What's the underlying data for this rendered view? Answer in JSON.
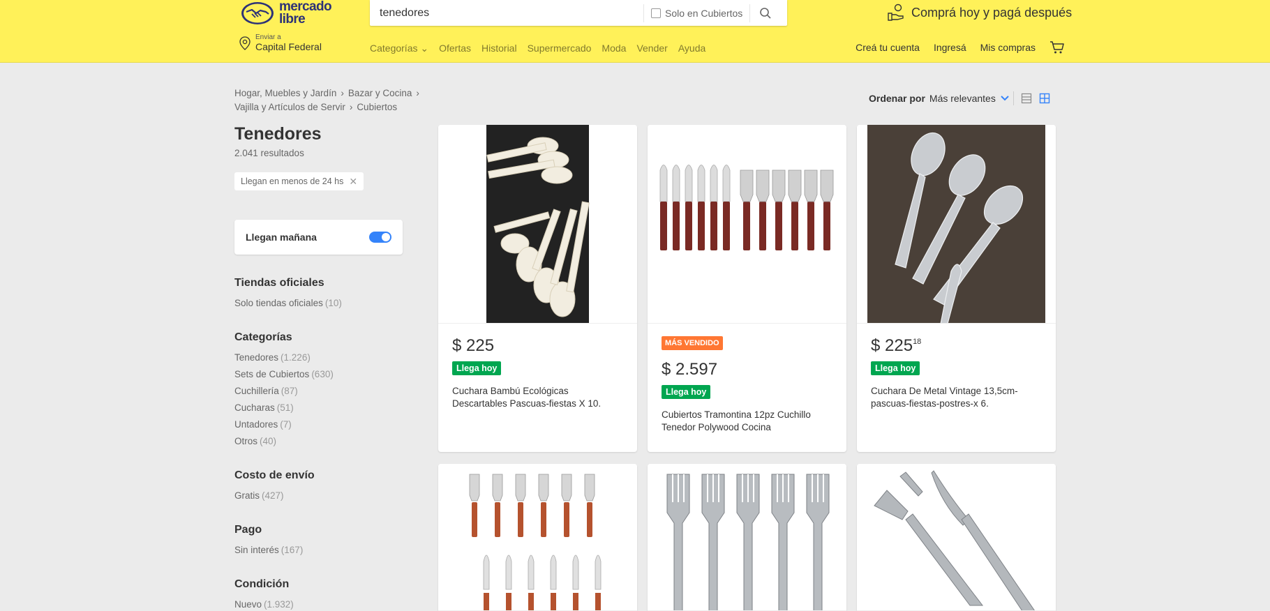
{
  "header": {
    "logo_text": "mercado libre",
    "search": {
      "value": "tenedores",
      "filter_label": "Solo en Cubiertos"
    },
    "promo": "Comprá hoy y pagá después",
    "location": {
      "small": "Enviar a",
      "big": "Capital Federal"
    },
    "nav": [
      "Categorías",
      "Ofertas",
      "Historial",
      "Supermercado",
      "Moda",
      "Vender",
      "Ayuda"
    ],
    "nav_right": [
      "Creá tu cuenta",
      "Ingresá",
      "Mis compras"
    ]
  },
  "breadcrumb": [
    "Hogar, Muebles y Jardín",
    "Bazar y Cocina",
    "Vajilla y Artículos de Servir",
    "Cubiertos"
  ],
  "sort": {
    "label": "Ordenar por",
    "value": "Más relevantes"
  },
  "sidebar": {
    "title": "Tenedores",
    "results": "2.041 resultados",
    "chip": "Llegan en menos de 24 hs",
    "toggle_label": "Llegan mañana",
    "groups": [
      {
        "title": "Tiendas oficiales",
        "items": [
          {
            "label": "Solo tiendas oficiales",
            "count": "(10)"
          }
        ]
      },
      {
        "title": "Categorías",
        "items": [
          {
            "label": "Tenedores",
            "count": "(1.226)"
          },
          {
            "label": "Sets de Cubiertos",
            "count": "(630)"
          },
          {
            "label": "Cuchillería",
            "count": "(87)"
          },
          {
            "label": "Cucharas",
            "count": "(51)"
          },
          {
            "label": "Untadores",
            "count": "(7)"
          },
          {
            "label": "Otros",
            "count": "(40)"
          }
        ]
      },
      {
        "title": "Costo de envío",
        "items": [
          {
            "label": "Gratis",
            "count": "(427)"
          }
        ]
      },
      {
        "title": "Pago",
        "items": [
          {
            "label": "Sin interés",
            "count": "(167)"
          }
        ]
      },
      {
        "title": "Condición",
        "items": [
          {
            "label": "Nuevo",
            "count": "(1.932)"
          }
        ]
      }
    ]
  },
  "products": [
    {
      "price": "$ 225",
      "cents": "",
      "badge_top": "",
      "badge": "Llega hoy",
      "title": "Cuchara Bambú Ecológicas Descartables Pascuas-fiestas X 10."
    },
    {
      "price": "$ 2.597",
      "cents": "",
      "badge_top": "MÁS VENDIDO",
      "badge": "Llega hoy",
      "title": "Cubiertos Tramontina 12pz Cuchillo Tenedor Polywood Cocina"
    },
    {
      "price": "$ 225",
      "cents": "18",
      "badge_top": "",
      "badge": "Llega hoy",
      "title": "Cuchara De Metal Vintage 13,5cm-pascuas-fiestas-postres-x 6."
    }
  ],
  "colors": {
    "header_bg": "#fff159",
    "accent_blue": "#3483fa",
    "green": "#00a650",
    "orange": "#ff7733"
  }
}
